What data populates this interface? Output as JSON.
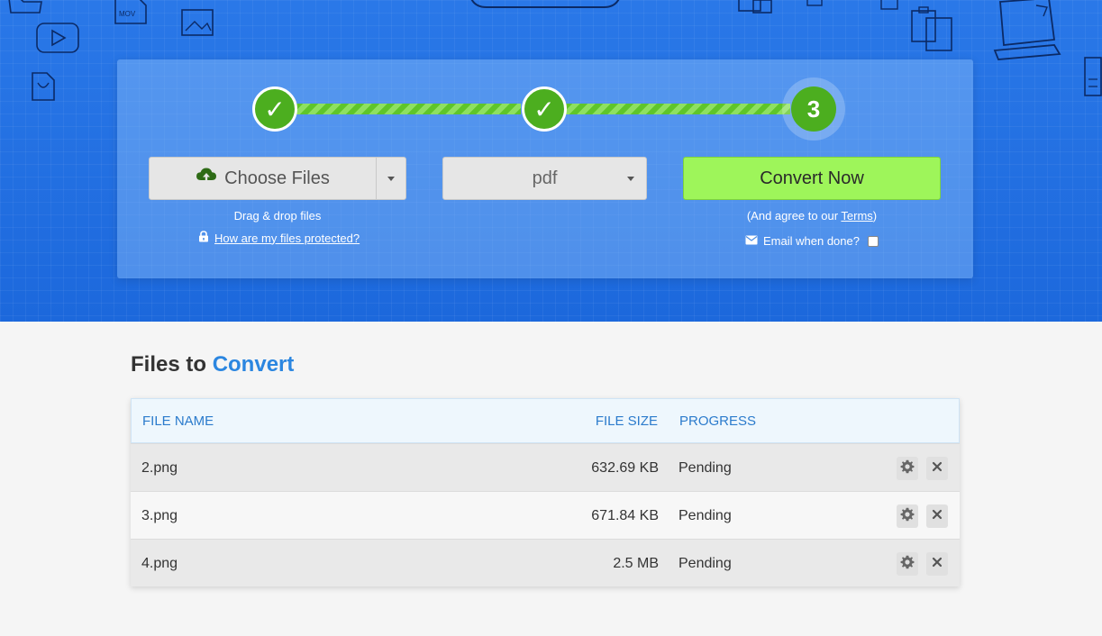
{
  "steps": [
    {
      "state": "done",
      "glyph": "✓"
    },
    {
      "state": "done",
      "glyph": "✓"
    },
    {
      "state": "current",
      "number": "3"
    }
  ],
  "uploader": {
    "choose_files_label": "Choose Files",
    "drag_drop_text": "Drag & drop files",
    "protection_link": "How are my files protected?"
  },
  "format_select": {
    "selected": "pdf"
  },
  "convert": {
    "button_label": "Convert Now",
    "agree_prefix": "(And agree to our ",
    "terms_link": "Terms",
    "agree_suffix": ")",
    "email_label": "Email when done?"
  },
  "files_section": {
    "title_prefix": "Files to",
    "title_accent": "Convert",
    "columns": {
      "name": "FILE NAME",
      "size": "FILE SIZE",
      "progress": "PROGRESS"
    },
    "rows": [
      {
        "name": "2.png",
        "size": "632.69 KB",
        "status": "Pending"
      },
      {
        "name": "3.png",
        "size": "671.84 KB",
        "status": "Pending"
      },
      {
        "name": "4.png",
        "size": "2.5 MB",
        "status": "Pending"
      }
    ]
  },
  "colors": {
    "hero_blue": "#1f6fe0",
    "step_green": "#4cae1f",
    "convert_green": "#9ef55a",
    "accent_blue": "#2b86e0"
  },
  "icons": [
    "upload-cloud-icon",
    "lock-icon",
    "envelope-icon",
    "gear-icon",
    "close-icon",
    "check-icon",
    "caret-down-icon"
  ]
}
